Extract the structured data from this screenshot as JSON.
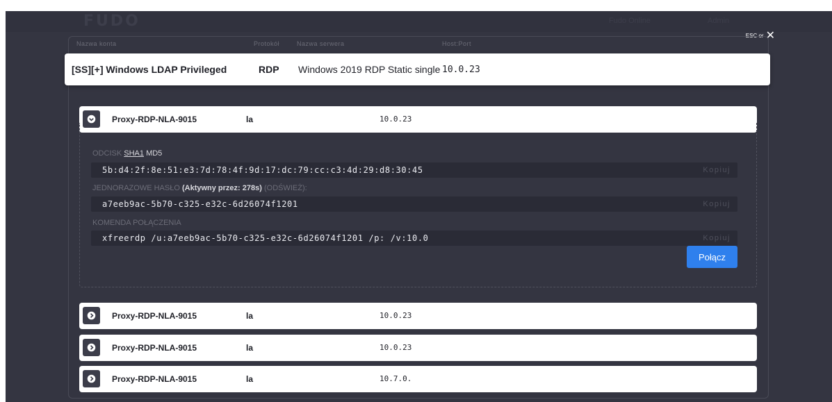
{
  "app": {
    "logo": "FUDO",
    "topbar_item_1": "Fudo Online",
    "topbar_item_2": "Admin"
  },
  "close_hint": {
    "label": "ESC or",
    "icon": "close-icon"
  },
  "columns": {
    "account": "Nazwa konta",
    "protocol": "Protokół",
    "server": "Nazwa serwera",
    "hostport": "Host:Port"
  },
  "account": {
    "name": "[SS][+] Windows LDAP Privileged",
    "protocol": "RDP",
    "server": "Windows 2019 RDP Static single",
    "hostport": "10.0.23"
  },
  "servers": [
    {
      "name": "Proxy-RDP-NLA-9015",
      "protocol": "la",
      "host": "10.0.23",
      "icon": "chevron-down-circle-icon",
      "expanded": true
    },
    {
      "name": "Proxy-RDP-NLA-9015",
      "protocol": "la",
      "host": "10.0.23",
      "icon": "chevron-right-circle-icon",
      "expanded": false
    },
    {
      "name": "Proxy-RDP-NLA-9015",
      "protocol": "la",
      "host": "10.0.23",
      "icon": "chevron-right-circle-icon",
      "expanded": false
    },
    {
      "name": "Proxy-RDP-NLA-9015",
      "protocol": "la",
      "host": "10.7.0.",
      "icon": "chevron-right-circle-icon",
      "expanded": false
    }
  ],
  "details": {
    "fingerprint_label": "ODCISK",
    "fingerprint_sha1": "SHA1",
    "fingerprint_md5": "MD5",
    "fingerprint_value": "5b:d4:2f:8e:51:e3:7d:78:4f:9d:17:dc:79:cc:c3:4d:29:d8:30:45",
    "otp_label": "JEDNORAZOWE HASŁO",
    "otp_active": "(Aktywny przez: 278s)",
    "otp_refresh": "(ODŚWIEŻ):",
    "otp_value": "a7eeb9ac-5b70-c325-e32c-6d26074f1201",
    "command_label": "KOMENDA POŁĄCZENIA",
    "command_value": "xfreerdp /u:a7eeb9ac-5b70-c325-e32c-6d26074f1201 /p: /v:10.0",
    "copy_label": "Kopiuj",
    "connect_label": "Połącz"
  },
  "colors": {
    "background": "#343541",
    "accent": "#2f80ed",
    "panel": "#ffffff",
    "field": "#2a2b36"
  }
}
